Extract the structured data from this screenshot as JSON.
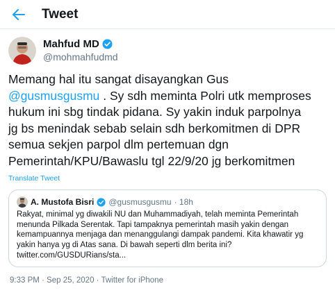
{
  "header": {
    "title": "Tweet",
    "back_icon": "arrow-left-icon"
  },
  "tweet": {
    "author": {
      "name": "Mahfud MD",
      "handle": "@mohmahfudmd",
      "verified": true
    },
    "text_lines": [
      {
        "before": "Memang hal itu sangat disayangkan Gus",
        "mention": "",
        "after": ""
      },
      {
        "before": "",
        "mention": "@gusmusgusmu",
        "after": " . Sy sdh meminta Polri utk memproses"
      },
      {
        "before": "hukum ini sbg tindak pidana. Sy yakin induk parpolnya",
        "mention": "",
        "after": ""
      },
      {
        "before": "jg bs menindak sebab selain sdh berkomitmen di DPR",
        "mention": "",
        "after": ""
      },
      {
        "before": "semua sekjen parpol dlm pertemuan dgn",
        "mention": "",
        "after": ""
      },
      {
        "before": "Pemerintah/KPU/Bawaslu tgl 22/9/20 jg berkomitmen",
        "mention": "",
        "after": ""
      }
    ],
    "translate_label": "Translate Tweet",
    "timestamp": "9:33 PM · Sep 25, 2020 · Twitter for iPhone"
  },
  "quote": {
    "author": {
      "name": "A. Mustofa Bisri",
      "handle": "@gusmusgusmu",
      "age": "· 18h",
      "verified": true
    },
    "text_lines": [
      "Rakyat, minimal yg diwakili NU dan Muhammadiyah, telah meminta Pemerintah",
      "menunda Pilkada Serentak. Tapi tampaknya pemerintah masih yakin dengan",
      "kemampuannya menjaga dan menanggulangi dampak pandemi. Kita khawatir yg",
      "yakin hanya yg di Atas sana. Di bawah seperti dlm berita ini?",
      "twitter.com/GUSDURians/sta..."
    ]
  },
  "colors": {
    "link": "#1da1f2",
    "secondary": "#657786",
    "border": "#ccd6dd"
  }
}
